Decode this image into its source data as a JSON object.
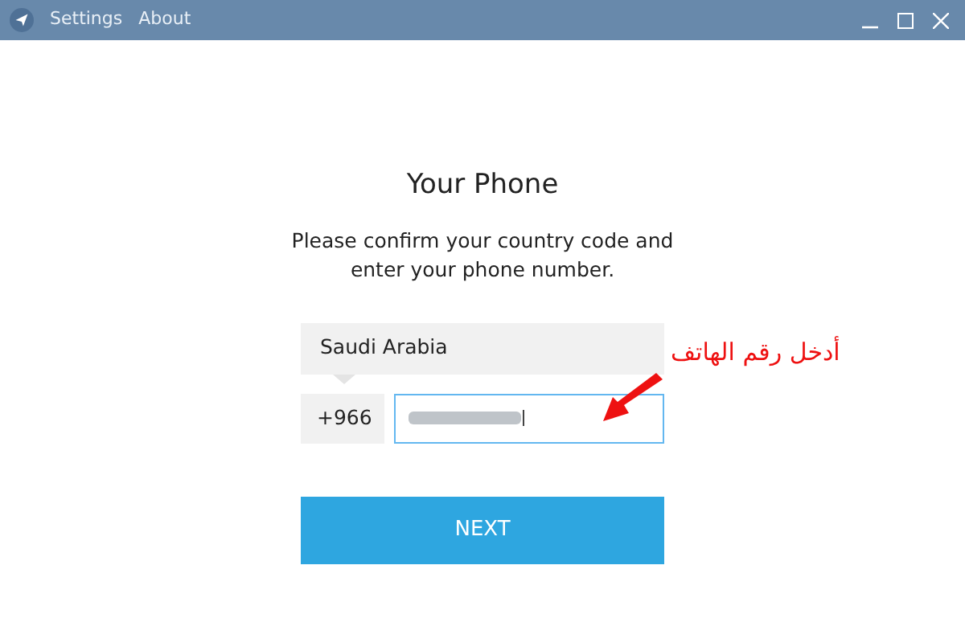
{
  "window": {
    "menu": [
      "Settings",
      "About"
    ]
  },
  "form": {
    "title": "Your Phone",
    "description": "Please confirm your country code and enter your phone number.",
    "country": "Saudi Arabia",
    "code": "+966",
    "button": "NEXT"
  },
  "annotation": {
    "text": "أدخل رقم الهاتف"
  }
}
